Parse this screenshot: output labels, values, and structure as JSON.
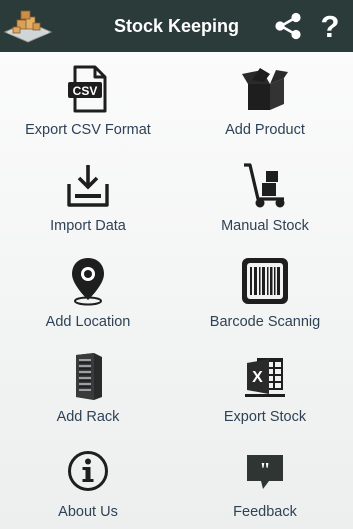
{
  "app_bar": {
    "title": "Stock Keeping",
    "logo_icon": "warehouse-boxes-icon",
    "share_icon": "share-icon",
    "help_glyph": "?",
    "background": "#2b3b39"
  },
  "menu": {
    "items": [
      {
        "label": "Export CSV Format",
        "icon": "csv-file-icon"
      },
      {
        "label": "Add Product",
        "icon": "open-box-icon"
      },
      {
        "label": "Import Data",
        "icon": "import-tray-icon"
      },
      {
        "label": "Manual Stock",
        "icon": "hand-truck-icon"
      },
      {
        "label": "Add Location",
        "icon": "location-pin-icon"
      },
      {
        "label": "Barcode Scannig",
        "icon": "barcode-icon"
      },
      {
        "label": "Add Rack",
        "icon": "server-rack-icon"
      },
      {
        "label": "Export Stock",
        "icon": "excel-export-icon"
      },
      {
        "label": "About Us",
        "icon": "info-icon"
      },
      {
        "label": "Feedback",
        "icon": "speech-bubble-icon"
      }
    ],
    "label_color": "#2f4256"
  }
}
